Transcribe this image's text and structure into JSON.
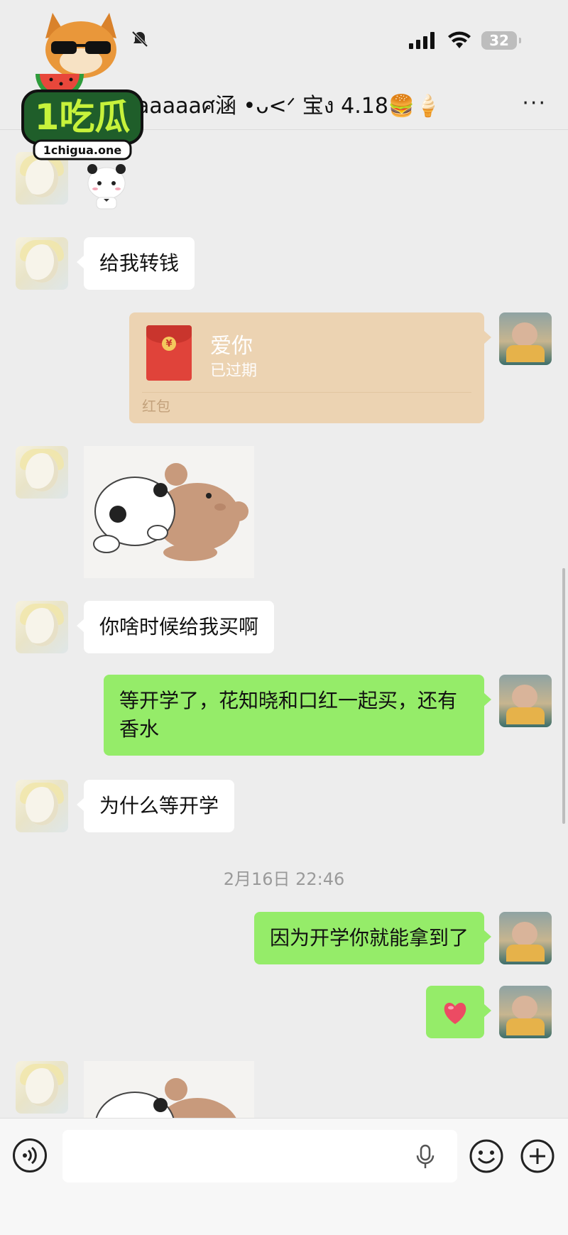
{
  "status_bar": {
    "battery": "32"
  },
  "header": {
    "title": "aaaaaศ涵 •ᴗ<ᐟ 宝ง 4.18🍔🍦",
    "more": "···"
  },
  "logo": {
    "brand": "1吃瓜",
    "site": "1chigua.one"
  },
  "messages": [
    {
      "id": "m1",
      "side": "left",
      "type": "text",
      "text": "给我转钱"
    },
    {
      "id": "m2",
      "side": "right",
      "type": "red_packet",
      "title": "爱你",
      "status": "已过期",
      "label": "红包"
    },
    {
      "id": "m3",
      "side": "left",
      "type": "sticker"
    },
    {
      "id": "m4",
      "side": "left",
      "type": "text",
      "text": "你啥时候给我买啊"
    },
    {
      "id": "m5",
      "side": "right",
      "type": "text",
      "text": "等开学了，花知晓和口红一起买，还有香水"
    },
    {
      "id": "m6",
      "side": "left",
      "type": "text",
      "text": "为什么等开学"
    },
    {
      "id": "m7",
      "side": "right",
      "type": "text",
      "text": "因为开学你就能拿到了"
    },
    {
      "id": "m8",
      "side": "right",
      "type": "emoji",
      "icon": "heart-icon"
    },
    {
      "id": "m9",
      "side": "left",
      "type": "sticker"
    }
  ],
  "timestamp": "2月16日 22:46",
  "input_bar": {
    "placeholder": ""
  },
  "colors": {
    "background": "#ededed",
    "incoming": "#ffffff",
    "outgoing": "#95ec69",
    "red_packet": "#ecd3b2"
  }
}
